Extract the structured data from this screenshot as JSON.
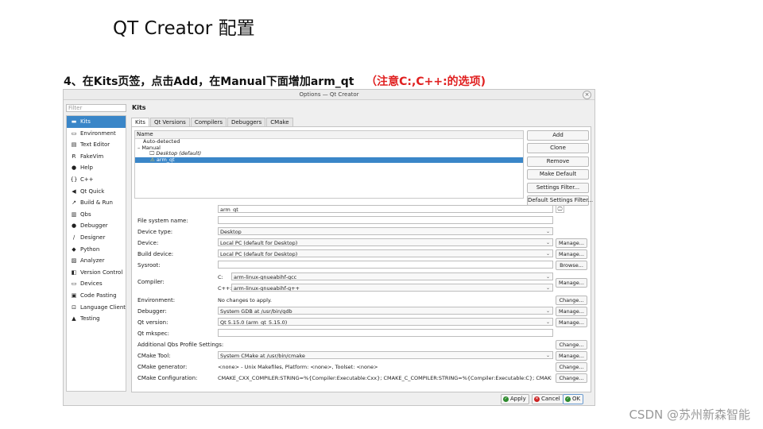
{
  "slide": {
    "title": "QT Creator 配置",
    "step_text": "4、在Kits页签，点击Add，在Manual下面增加arm_qt",
    "step_note": "（注意C:,C++:的选项)",
    "watermark": "CSDN @苏州新森智能"
  },
  "colors": {
    "accent": "#3a86c8",
    "note": "#e02020"
  },
  "window": {
    "title": "Options — Qt Creator",
    "close_glyph": "×",
    "filter_placeholder": "Filter",
    "sidebar": [
      {
        "label": "Kits",
        "icon": "kits-icon",
        "glyph": "▬",
        "selected": true
      },
      {
        "label": "Environment",
        "icon": "monitor-icon",
        "glyph": "▭"
      },
      {
        "label": "Text Editor",
        "icon": "text-editor-icon",
        "glyph": "▤"
      },
      {
        "label": "FakeVim",
        "icon": "fakevim-icon",
        "glyph": "Ɍ"
      },
      {
        "label": "Help",
        "icon": "help-icon",
        "glyph": "●"
      },
      {
        "label": "C++",
        "icon": "cpp-icon",
        "glyph": "{}"
      },
      {
        "label": "Qt Quick",
        "icon": "qt-quick-icon",
        "glyph": "◀"
      },
      {
        "label": "Build & Run",
        "icon": "build-run-icon",
        "glyph": "↗"
      },
      {
        "label": "Qbs",
        "icon": "qbs-icon",
        "glyph": "▥"
      },
      {
        "label": "Debugger",
        "icon": "debugger-icon",
        "glyph": "●"
      },
      {
        "label": "Designer",
        "icon": "designer-icon",
        "glyph": "∕"
      },
      {
        "label": "Python",
        "icon": "python-icon",
        "glyph": "◆"
      },
      {
        "label": "Analyzer",
        "icon": "analyzer-icon",
        "glyph": "▨"
      },
      {
        "label": "Version Control",
        "icon": "version-control-icon",
        "glyph": "◧"
      },
      {
        "label": "Devices",
        "icon": "devices-icon",
        "glyph": "▭"
      },
      {
        "label": "Code Pasting",
        "icon": "code-pasting-icon",
        "glyph": "▣"
      },
      {
        "label": "Language Client",
        "icon": "language-client-icon",
        "glyph": "⊡"
      },
      {
        "label": "Testing",
        "icon": "testing-icon",
        "glyph": "▲"
      }
    ],
    "page_title": "Kits",
    "tabs": [
      {
        "label": "Kits",
        "selected": true
      },
      {
        "label": "Qt Versions"
      },
      {
        "label": "Compilers"
      },
      {
        "label": "Debuggers"
      },
      {
        "label": "CMake"
      }
    ],
    "tree": {
      "header": "Name",
      "auto_detected": "Auto-detected",
      "manual": "Manual",
      "desktop": "Desktop (default)",
      "arm_qt": "arm_qt",
      "collapse_glyph": "–",
      "warn_glyph": "⚠",
      "monitor_glyph": "🖵"
    },
    "buttons": [
      "Add",
      "Clone",
      "Remove",
      "Make Default",
      "Settings Filter...",
      "Default Settings Filter..."
    ],
    "form": {
      "name_value": "arm_qt",
      "name_icon_glyph": "🖵",
      "file_system_name": {
        "label": "File system name:",
        "value": ""
      },
      "device_type": {
        "label": "Device type:",
        "value": "Desktop"
      },
      "device": {
        "label": "Device:",
        "value": "Local PC (default for Desktop)",
        "button": "Manage..."
      },
      "build_device": {
        "label": "Build device:",
        "value": "Local PC (default for Desktop)",
        "button": "Manage..."
      },
      "sysroot": {
        "label": "Sysroot:",
        "value": "",
        "button": "Browse..."
      },
      "compiler": {
        "label": "Compiler:",
        "c_label": "C:",
        "c_value": "arm-linux-gnueabihf-gcc",
        "cpp_label": "C++:",
        "cpp_value": "arm-linux-gnueabihf-g++",
        "button": "Manage..."
      },
      "environment": {
        "label": "Environment:",
        "value": "No changes to apply.",
        "button": "Change..."
      },
      "debugger": {
        "label": "Debugger:",
        "value": "System GDB at /usr/bin/gdb",
        "button": "Manage..."
      },
      "qt_version": {
        "label": "Qt version:",
        "value": "Qt 5.15.0 (arm_qt_5.15.0)",
        "button": "Manage..."
      },
      "qt_mkspec": {
        "label": "Qt mkspec:",
        "value": ""
      },
      "qbs_profile": {
        "label": "Additional Qbs Profile Settings:",
        "button": "Change..."
      },
      "cmake_tool": {
        "label": "CMake Tool:",
        "value": "System CMake at /usr/bin/cmake",
        "button": "Manage..."
      },
      "cmake_generator": {
        "label": "CMake generator:",
        "value": "<none> - Unix Makefiles, Platform: <none>, Toolset: <none>",
        "button": "Change..."
      },
      "cmake_config": {
        "label": "CMake Configuration:",
        "value": "CMAKE_CXX_COMPILER:STRING=%{Compiler:Executable:Cxx}; CMAKE_C_COMPILER:STRING=%{Compiler:Executable:C}; CMAKE_PR...",
        "button": "Change..."
      }
    },
    "combo_arrow": "⌄",
    "footer": {
      "apply": "Apply",
      "apply_glyph": "✓",
      "apply_color": "#2e8b2e",
      "cancel": "Cancel",
      "cancel_glyph": "✕",
      "cancel_color": "#cc2222",
      "ok": "OK",
      "ok_glyph": "✓",
      "ok_color": "#2e8b2e"
    }
  }
}
